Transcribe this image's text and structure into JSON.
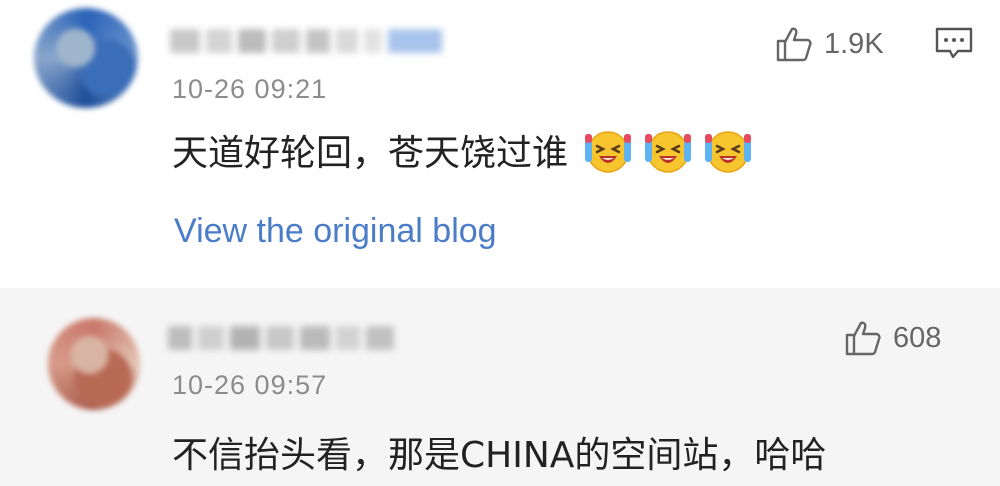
{
  "comments": [
    {
      "timestamp": "10-26 09:21",
      "text": "天道好轮回，苍天饶过谁",
      "emojis": [
        "laughing-crying-emoji",
        "laughing-crying-emoji",
        "laughing-crying-emoji"
      ],
      "likes": "1.9K",
      "link": "View the original blog",
      "icons": [
        "thumbs-up-icon",
        "reply-comment-icon"
      ]
    },
    {
      "timestamp": "10-26 09:57",
      "text": "不信抬头看，那是CHINA的空间站，哈哈",
      "likes": "608",
      "icons": [
        "thumbs-up-icon"
      ]
    }
  ],
  "colors": {
    "link": "#4a7cc7",
    "timestamp": "#8c8c8c",
    "text": "#222222",
    "second_row_bg": "#f5f5f5"
  }
}
